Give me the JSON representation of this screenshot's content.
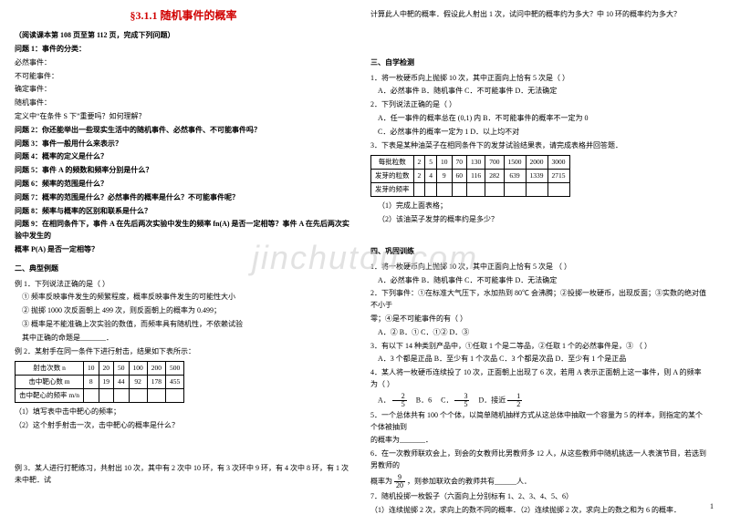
{
  "watermark": "jinchutou.com",
  "pagenum": "1",
  "left": {
    "title": "§3.1.1 随机事件的概率",
    "read_note": "（阅读课本第 108 页至第 112 页，完成下列问题）",
    "q1_head": "问题 1：事件的分类：",
    "q1_a": "必然事件：",
    "q1_b": "不可能事件：",
    "q1_c": "确定事件：",
    "q1_d": "随机事件：",
    "q1_e": "定义中“在条件 S 下”重要吗？如何理解？",
    "q2": "问题 2：你还能举出一些现实生活中的随机事件、必然事件、不可能事件吗？",
    "q3": "问题 3：事件一般用什么来表示？",
    "q4": "问题 4：概率的定义是什么？",
    "q5": "问题 5：事件 A 的频数和频率分别是什么？",
    "q6": "问题 6：频率的范围是什么？",
    "q7": "问题 7：概率的范围是什么？必然事件的概率是什么？不可能事件呢？",
    "q8": "问题 8：频率与概率的区别和联系是什么？",
    "q9a": "问题 9：在相同条件下，事件 A 在先后两次实验中发生的频率 fn(A) 是否一定相等？事件 A 在先后两次实验中发生的",
    "q9b": "概率 P(A) 是否一定相等？",
    "ex_head": "二、典型例题",
    "ex1_head": "例 1．下列说法正确的是（     ）",
    "ex1_1": "① 频率反映事件发生的频繁程度，概率反映事件发生的可能性大小",
    "ex1_2": "② 抛掷 1000 次反面朝上 499 次，则反面朝上的概率为 0.499；",
    "ex1_3": "③ 概率是不能准确上次实验的数值，而频率具有随机性，不依赖试验",
    "ex1_4": "   其中正确的命题是_______．",
    "ex2_head": "例 2．某射手在同一条件下进行射击，结果如下表所示：",
    "t1": {
      "r1": [
        "射击次数 n",
        "10",
        "20",
        "50",
        "100",
        "200",
        "500"
      ],
      "r2": [
        "击中靶心数 m",
        "8",
        "19",
        "44",
        "92",
        "178",
        "455"
      ],
      "r3": [
        "击中靶心的频率 m/n",
        "",
        "",
        "",
        "",
        "",
        ""
      ]
    },
    "ex2_q1": "（1）填写表中击中靶心的频率；",
    "ex2_q2": "（2）这个射手射击一次，击中靶心的概率是什么？",
    "ex3": "例 3．某人进行打靶练习，共射出 10 次，其中有 2 次中 10 环，有 3 次环中 9 环，有 4 次中 8 环，有 1 次未中靶．试"
  },
  "right": {
    "top_line": "计算此人中靶的概率．假设此人射出 1 次，试问中靶的概率约为多大？中 10 环的概率约为多大？",
    "sec3_head": "三、自学检测",
    "s3_1": "1．将一枚硬币向上抛掷 10 次，其中正面向上恰有 5 次是（     ）",
    "s3_1_opts": "A．必然事件      B．随机事件      C．不可能事件      D．无法确定",
    "s3_2": "2．下列说法正确的是（     ）",
    "s3_2a": "A．任一事件的概率总在 (0,1) 内        B．不可能事件的概率不一定为 0",
    "s3_2b": "C．必然事件的概率一定为 1             D．以上均不对",
    "s3_3": "3．下表是某种油菜子在相同条件下的发芽试验结果表，请完成表格并回答题．",
    "t2": {
      "r1": [
        "每批粒数",
        "2",
        "5",
        "10",
        "70",
        "130",
        "700",
        "1500",
        "2000",
        "3000"
      ],
      "r2": [
        "发芽的粒数",
        "2",
        "4",
        "9",
        "60",
        "116",
        "282",
        "639",
        "1339",
        "2715"
      ],
      "r3": [
        "发芽的频率",
        "",
        "",
        "",
        "",
        "",
        "",
        "",
        "",
        ""
      ]
    },
    "s3_3a": "（1）完成上面表格；",
    "s3_3b": "（2）该油菜子发芽的概率约是多少？",
    "sec4_head": "四、巩固训练",
    "s4_1": "1．将一枚硬币向上抛掷 10 次，其中正面向上恰有 5 次是                       （     ）",
    "s4_1_opts": "A．必然事件      B．随机事件      C．不可能事件      D．无法确定",
    "s4_2": "2．下列事件：①在标准大气压下，水加热到 80℃ 会沸腾；②投掷一枚硬币，出现反面；③实数的绝对值不小于",
    "s4_2b": "零；④是不可能事件的有（     ）",
    "s4_2_opts": "A．②     B．①     C．①②     D．③",
    "s4_3": "3．有以下 14 种类别产品中，①任取 1 个是二等品，②任取 1 个的必然事件是，③                              （     ）",
    "s4_3_opts": "A．3 个都是正品    B．至少有 1 个次品    C．3 个都是次品    D．至少有 1 个是正品",
    "s4_4_a": "4．某人将一枚硬币连续投了 10 次，正面朝上出现了 6 次，若用 A 表示正面朝上这一事件，则 A 的频率为（     ）",
    "s4_4_opts_a": "A．",
    "s4_4_opts_b": "B．6",
    "s4_4_opts_c": "C．",
    "s4_4_opts_d": "D．接近",
    "s4_5": "5．一个总体共有 100 个个体，以简单随机抽样方式从这总体中抽取一个容量为 5 的样本，则指定的某个个体被抽到",
    "s4_5b": "的概率为_______．",
    "s4_6a": "6．在一次教师联欢会上，到会的女教师比男教师多 12 人，从这些教师中随机挑选一人表演节目，若选到男教师的",
    "s4_6b": "概率为",
    "s4_6c": "，则参加联欢会的教师共有______人．",
    "s4_7": "7．随机投掷一枚骰子（六面向上分别标有 1、2、3、4、5、6）",
    "s4_7a": "（1）连续抛掷 2 次，求向上的数不同的概率．（2）连续抛掷 2 次，求向上的数之和为 6 的概率．",
    "frac_2_5_num": "2",
    "frac_2_5_den": "5",
    "frac_3_5_num": "3",
    "frac_3_5_den": "5",
    "frac_9_20_num": "9",
    "frac_9_20_den": "20",
    "frac_1_2_num": "1",
    "frac_1_2_den": "2"
  }
}
